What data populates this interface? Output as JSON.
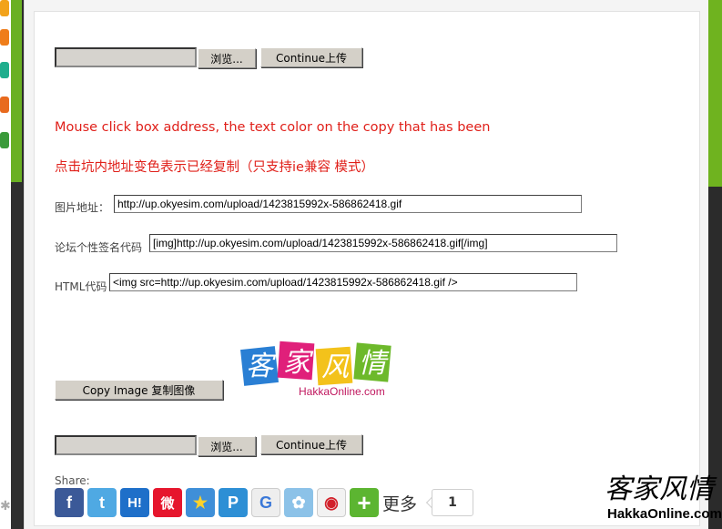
{
  "upload_top": {
    "browse_label": "浏览...",
    "continue_label": "Continue上传"
  },
  "notice": {
    "english": "Mouse click box address, the text color on the copy that has been",
    "chinese": "点击坑内地址变色表示已经复制（只支持ie兼容 模式）"
  },
  "fields": [
    {
      "label": "图片地址：",
      "value": "http://up.okyesim.com/upload/1423815992x-586862418.gif"
    },
    {
      "label": "论坛个性签名代码",
      "value": "[img]http://up.okyesim.com/upload/1423815992x-586862418.gif[/img]"
    },
    {
      "label": "HTML代码",
      "value": "<img src=http://up.okyesim.com/upload/1423815992x-586862418.gif />"
    }
  ],
  "copy_button_label": "Copy Image 复制图像",
  "logo": {
    "chars": [
      "客",
      "家",
      "风",
      "情"
    ],
    "site": "HakkaOnline.com"
  },
  "upload_bottom": {
    "browse_label": "浏览...",
    "continue_label": "Continue上传"
  },
  "share": {
    "label": "Share:",
    "icons": [
      {
        "name": "facebook-icon",
        "glyph": "f",
        "color": "#3b5998"
      },
      {
        "name": "twitter-icon",
        "glyph": "t",
        "color": "#4fa9e3"
      },
      {
        "name": "hatena-icon",
        "glyph": "H!",
        "color": "#1e6fc9"
      },
      {
        "name": "weibo-icon",
        "glyph": "微",
        "color": "#e6162d"
      },
      {
        "name": "star-bookmark-icon",
        "glyph": "★",
        "color": "#3f8fd8"
      },
      {
        "name": "pinterest-icon",
        "glyph": "P",
        "color": "#2d8fd5"
      },
      {
        "name": "google-icon",
        "glyph": "G",
        "color": "#eeeeee"
      },
      {
        "name": "messenger-icon",
        "glyph": "✿",
        "color": "#8cc2e8"
      },
      {
        "name": "qq-icon",
        "glyph": "◉",
        "color": "#f2f2f2"
      },
      {
        "name": "add-more-icon",
        "glyph": "+",
        "color": "#5cb531"
      }
    ],
    "more_label": "更多",
    "count": "1"
  },
  "watermark": {
    "chars": "客家风情",
    "site": "HakkaOnline.com"
  }
}
